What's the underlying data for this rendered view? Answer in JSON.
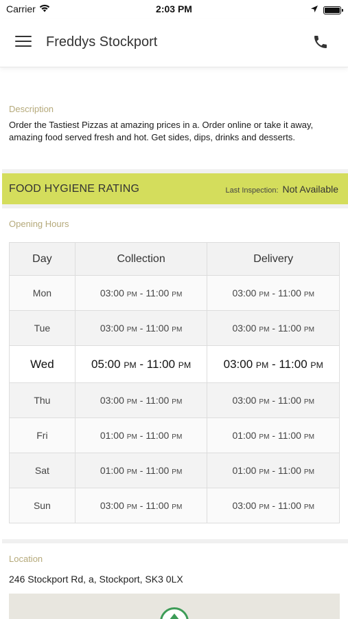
{
  "status_bar": {
    "carrier": "Carrier",
    "time": "2:03 PM",
    "icons": [
      "wifi-icon",
      "location-arrow-icon",
      "battery-icon"
    ]
  },
  "header": {
    "title": "Freddys Stockport",
    "menu_icon": "hamburger-menu-icon",
    "phone_icon": "phone-icon"
  },
  "description": {
    "label": "Description",
    "text": "Order the Tastiest Pizzas at amazing prices in a. Order online or take it away, amazing food served fresh and hot. Get sides, dips, drinks and desserts."
  },
  "hygiene": {
    "title": "FOOD HYGIENE RATING",
    "inspection_label": "Last Inspection:",
    "inspection_value": "Not Available",
    "color": "#d4dd5c"
  },
  "opening_hours": {
    "label": "Opening Hours",
    "headers": [
      "Day",
      "Collection",
      "Delivery"
    ],
    "rows": [
      {
        "day": "Mon",
        "collection": {
          "start": "03:00",
          "end": "11:00"
        },
        "delivery": {
          "start": "03:00",
          "end": "11:00"
        }
      },
      {
        "day": "Tue",
        "collection": {
          "start": "03:00",
          "end": "11:00"
        },
        "delivery": {
          "start": "03:00",
          "end": "11:00"
        }
      },
      {
        "day": "Wed",
        "collection": {
          "start": "05:00",
          "end": "11:00"
        },
        "delivery": {
          "start": "03:00",
          "end": "11:00"
        },
        "today": true
      },
      {
        "day": "Thu",
        "collection": {
          "start": "03:00",
          "end": "11:00"
        },
        "delivery": {
          "start": "03:00",
          "end": "11:00"
        }
      },
      {
        "day": "Fri",
        "collection": {
          "start": "01:00",
          "end": "11:00"
        },
        "delivery": {
          "start": "01:00",
          "end": "11:00"
        }
      },
      {
        "day": "Sat",
        "collection": {
          "start": "01:00",
          "end": "11:00"
        },
        "delivery": {
          "start": "01:00",
          "end": "11:00"
        }
      },
      {
        "day": "Sun",
        "collection": {
          "start": "03:00",
          "end": "11:00"
        },
        "delivery": {
          "start": "03:00",
          "end": "11:00"
        }
      }
    ],
    "meridiem": "PM",
    "separator": " - "
  },
  "location": {
    "label": "Location",
    "address": "246 Stockport Rd, a, Stockport, SK3 0LX",
    "map_pin_icon": "map-pin-icon",
    "accent": "#3d9c57"
  },
  "colors": {
    "section_label": "#b5a97a"
  }
}
